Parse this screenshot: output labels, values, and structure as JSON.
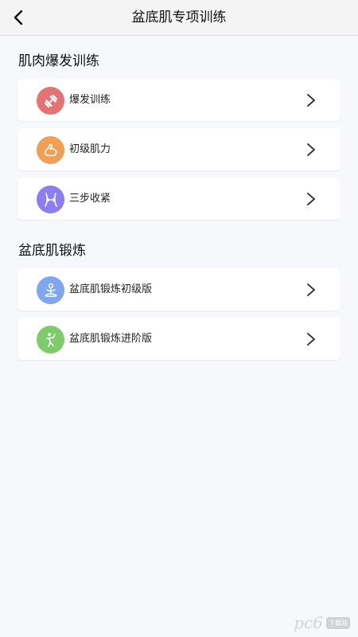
{
  "header": {
    "title": "盆底肌专项训练",
    "back_icon": "chevron-left-icon"
  },
  "sections": [
    {
      "title": "肌肉爆发训练",
      "items": [
        {
          "label": "爆发训练",
          "icon": "dumbbell-icon",
          "color": "#e57373"
        },
        {
          "label": "初级肌力",
          "icon": "flexed-arm-icon",
          "color": "#f0a055"
        },
        {
          "label": "三步收紧",
          "icon": "waist-icon",
          "color": "#8c7ef0"
        }
      ]
    },
    {
      "title": "盆底肌锻炼",
      "items": [
        {
          "label": "盆底肌锻炼初级版",
          "icon": "meditation-icon",
          "color": "#7ea7f0"
        },
        {
          "label": "盆底肌锻炼进阶版",
          "icon": "stretch-icon",
          "color": "#7ccc6a"
        }
      ]
    }
  ],
  "watermark": {
    "text": "pc6",
    "badge": "下载站"
  },
  "colors": {
    "background": "#f7f8fc",
    "card": "#ffffff",
    "nav_bg": "#f4f4f4"
  }
}
